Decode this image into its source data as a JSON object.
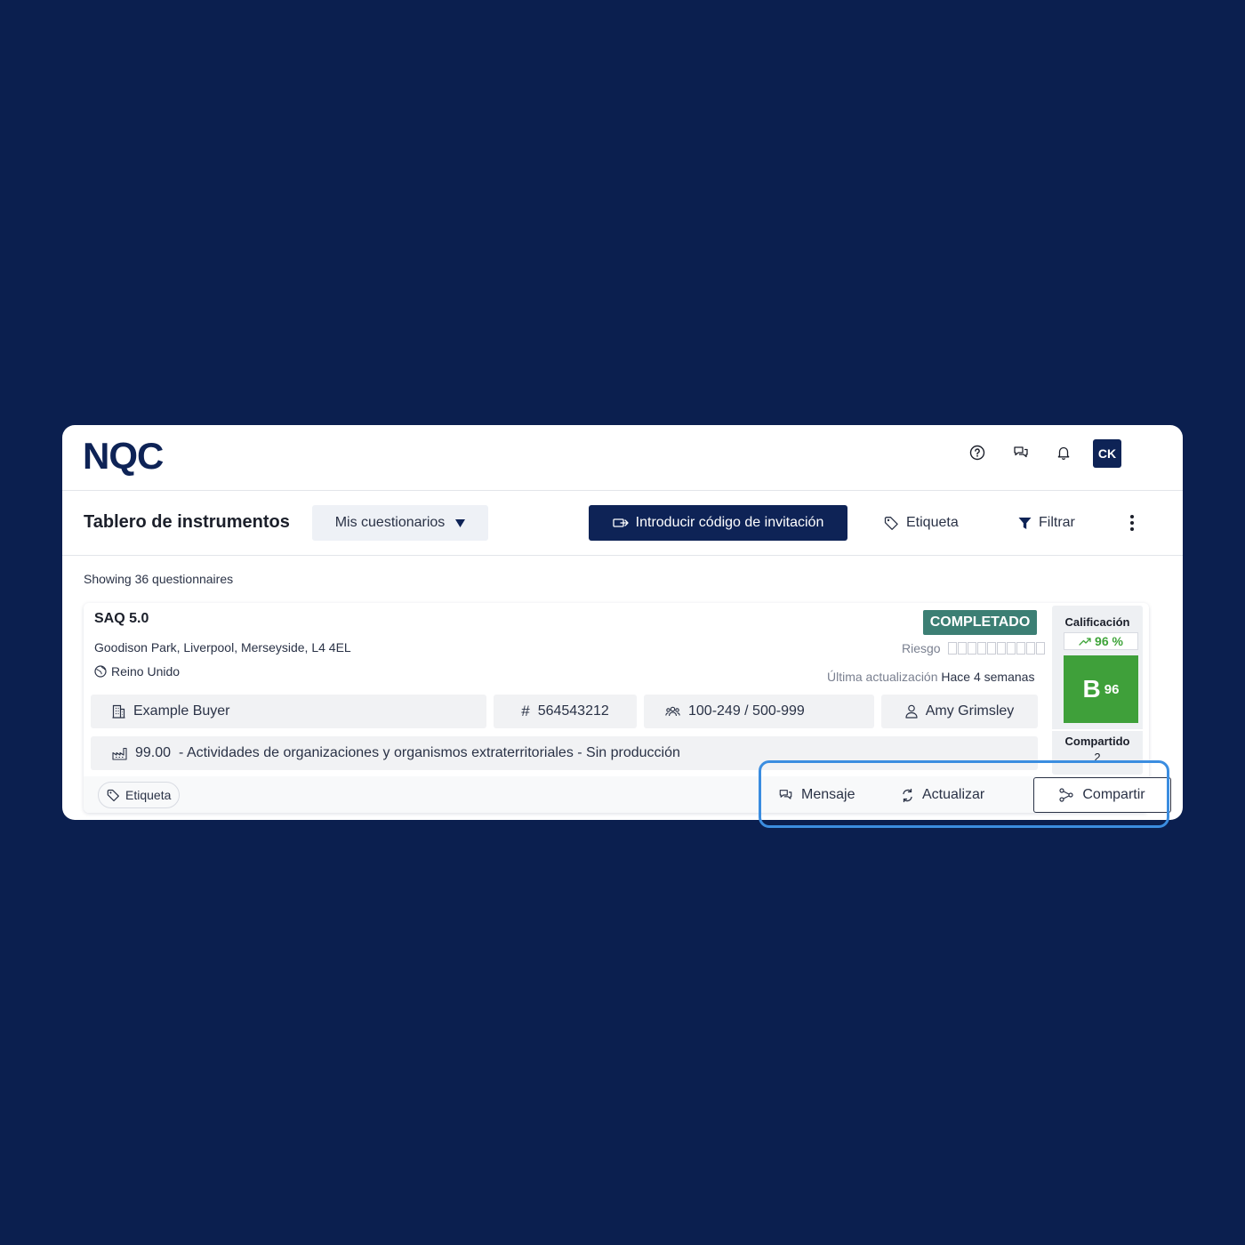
{
  "header": {
    "logo_text": "NQC",
    "avatar_initials": "CK",
    "icons": [
      "help-icon",
      "messages-icon",
      "bell-icon"
    ]
  },
  "toolbar": {
    "page_title": "Tablero de instrumentos",
    "dropdown_label": "Mis cuestionarios",
    "invite_button_label": "Introducir código de invitación",
    "tag_button_label": "Etiqueta",
    "filter_button_label": "Filtrar"
  },
  "list": {
    "showing_text": "Showing 36 questionnaires"
  },
  "card": {
    "title": "SAQ 5.0",
    "address": "Goodison Park, Liverpool, Merseyside, L4 4EL",
    "country": "Reino Unido",
    "status": "COMPLETADO",
    "risk_label": "Riesgo",
    "updated_label": "Última actualización",
    "updated_value": "Hace 4 semanas",
    "buyer": "Example Buyer",
    "id_number": "564543212",
    "employees": "100-249 / 500-999",
    "contact": "Amy Grimsley",
    "industry_code": "99.00",
    "industry_desc": "- Actividades de organizaciones y organismos extraterritoriales - Sin producción",
    "tag_label": "Etiqueta",
    "score": {
      "title": "Calificación",
      "trend": "96 %",
      "grade_letter": "B",
      "grade_value": "96",
      "shared_label": "Compartido",
      "shared_count": "2"
    },
    "actions": {
      "message_label": "Mensaje",
      "update_label": "Actualizar",
      "share_label": "Compartir"
    }
  },
  "colors": {
    "background": "#0b1f4f",
    "primary": "#0e2356",
    "status_completed": "#3c7f74",
    "grade_green": "#3fa03a",
    "highlight": "#3b8de0"
  }
}
